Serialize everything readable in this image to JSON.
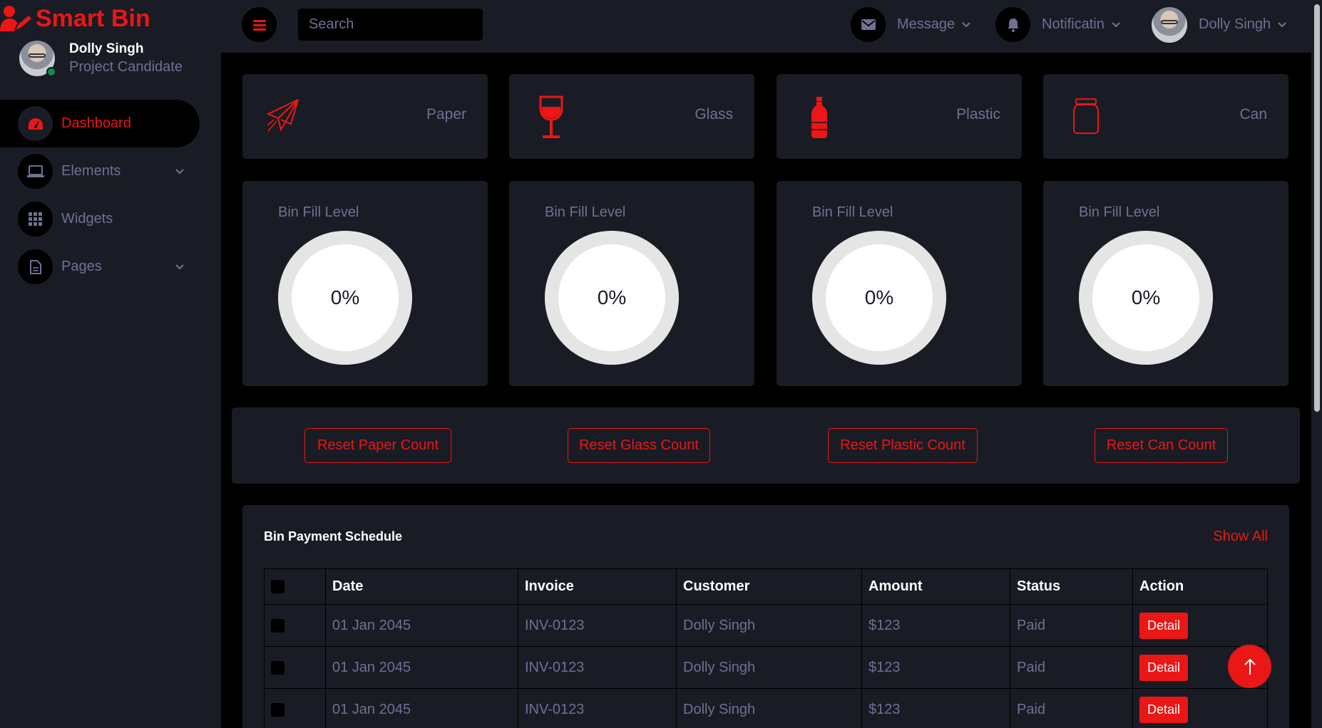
{
  "brand": {
    "name": "Smart Bin"
  },
  "profile": {
    "name": "Dolly Singh",
    "role": "Project Candidate"
  },
  "sidebar": {
    "items": [
      {
        "label": "Dashboard",
        "icon": "speedometer-icon",
        "active": true
      },
      {
        "label": "Elements",
        "icon": "laptop-icon",
        "has_submenu": true
      },
      {
        "label": "Widgets",
        "icon": "grid-icon"
      },
      {
        "label": "Pages",
        "icon": "file-icon",
        "has_submenu": true
      }
    ]
  },
  "topbar": {
    "search_placeholder": "Search",
    "message_label": "Message",
    "notification_label": "Notificatin",
    "user_name": "Dolly Singh"
  },
  "categories": [
    {
      "label": "Paper",
      "icon": "paper-plane-icon"
    },
    {
      "label": "Glass",
      "icon": "wine-glass-icon"
    },
    {
      "label": "Plastic",
      "icon": "bottle-icon"
    },
    {
      "label": "Can",
      "icon": "jar-icon"
    }
  ],
  "fill_levels": [
    {
      "title": "Bin Fill Level",
      "value": "0%"
    },
    {
      "title": "Bin Fill Level",
      "value": "0%"
    },
    {
      "title": "Bin Fill Level",
      "value": "0%"
    },
    {
      "title": "Bin Fill Level",
      "value": "0%"
    }
  ],
  "reset_buttons": [
    "Reset Paper Count",
    "Reset Glass Count",
    "Reset Plastic Count",
    "Reset Can Count"
  ],
  "payments": {
    "title": "Bin Payment Schedule",
    "show_all": "Show All",
    "columns": [
      "Date",
      "Invoice",
      "Customer",
      "Amount",
      "Status",
      "Action"
    ],
    "rows": [
      {
        "date": "01 Jan 2045",
        "invoice": "INV-0123",
        "customer": "Dolly Singh",
        "amount": "$123",
        "status": "Paid",
        "action": "Detail"
      },
      {
        "date": "01 Jan 2045",
        "invoice": "INV-0123",
        "customer": "Dolly Singh",
        "amount": "$123",
        "status": "Paid",
        "action": "Detail"
      },
      {
        "date": "01 Jan 2045",
        "invoice": "INV-0123",
        "customer": "Dolly Singh",
        "amount": "$123",
        "status": "Paid",
        "action": "Detail"
      }
    ]
  },
  "colors": {
    "accent": "#eb1616",
    "panel": "#191c24",
    "background": "#000000",
    "muted": "#6c7293"
  }
}
